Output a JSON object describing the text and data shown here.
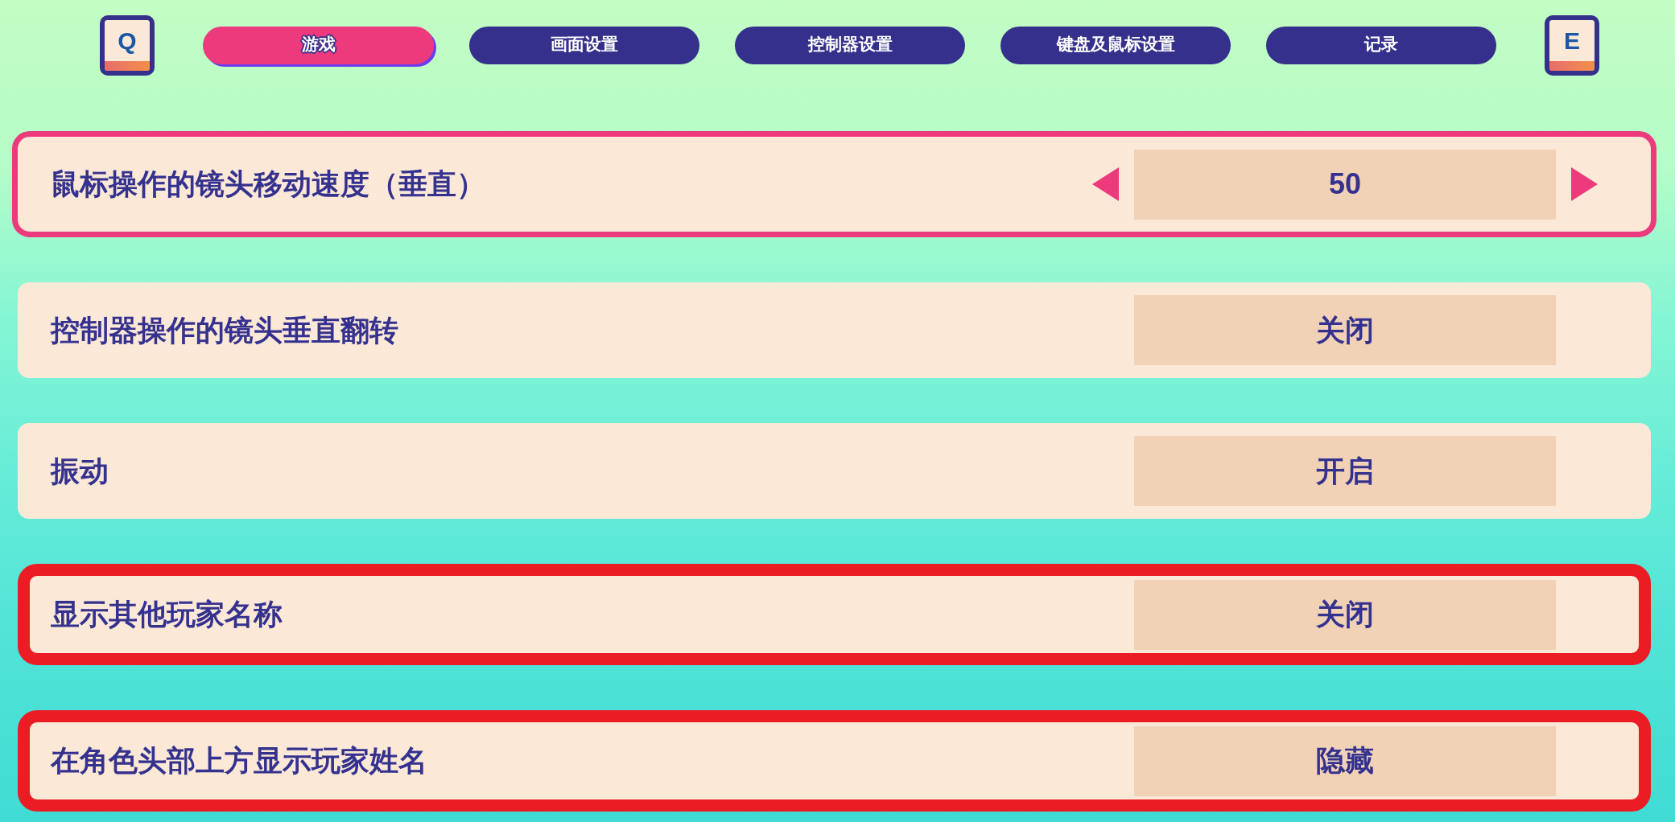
{
  "navigation": {
    "prev_key": "Q",
    "next_key": "E",
    "tabs": [
      {
        "label": "游戏",
        "selected": true
      },
      {
        "label": "画面设置",
        "selected": false
      },
      {
        "label": "控制器设置",
        "selected": false
      },
      {
        "label": "键盘及鼠标设置",
        "selected": false
      },
      {
        "label": "记录",
        "selected": false
      }
    ]
  },
  "settings": [
    {
      "label": "鼠标操作的镜头移动速度（垂直）",
      "value": "50",
      "selected": true,
      "highlighted": false
    },
    {
      "label": "控制器操作的镜头垂直翻转",
      "value": "关闭",
      "selected": false,
      "highlighted": false
    },
    {
      "label": "振动",
      "value": "开启",
      "selected": false,
      "highlighted": false
    },
    {
      "label": "显示其他玩家名称",
      "value": "关闭",
      "selected": false,
      "highlighted": true
    },
    {
      "label": "在角色头部上方显示玩家姓名",
      "value": "隐藏",
      "selected": false,
      "highlighted": true
    }
  ]
}
